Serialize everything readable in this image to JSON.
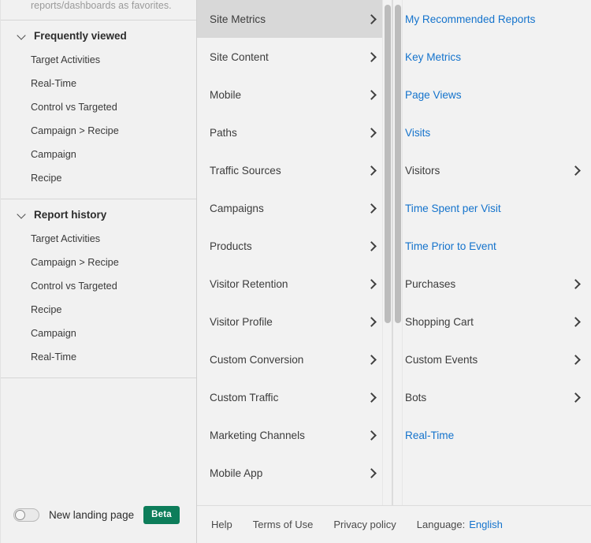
{
  "sidebar": {
    "intro_text": "reports/dashboards as favorites.",
    "sections": [
      {
        "title": "Frequently viewed",
        "items": [
          "Target Activities",
          "Real-Time",
          "Control vs Targeted",
          "Campaign > Recipe",
          "Campaign",
          "Recipe"
        ]
      },
      {
        "title": "Report history",
        "items": [
          "Target Activities",
          "Campaign > Recipe",
          "Control vs Targeted",
          "Recipe",
          "Campaign",
          "Real-Time"
        ]
      }
    ],
    "footer": {
      "toggle_state": "off",
      "landing_label": "New landing page",
      "beta_label": "Beta"
    }
  },
  "menu_column_1": {
    "items": [
      {
        "label": "Site Metrics",
        "has_submenu": true,
        "selected": true,
        "is_link": false
      },
      {
        "label": "Site Content",
        "has_submenu": true,
        "selected": false,
        "is_link": false
      },
      {
        "label": "Mobile",
        "has_submenu": true,
        "selected": false,
        "is_link": false
      },
      {
        "label": "Paths",
        "has_submenu": true,
        "selected": false,
        "is_link": false
      },
      {
        "label": "Traffic Sources",
        "has_submenu": true,
        "selected": false,
        "is_link": false
      },
      {
        "label": "Campaigns",
        "has_submenu": true,
        "selected": false,
        "is_link": false
      },
      {
        "label": "Products",
        "has_submenu": true,
        "selected": false,
        "is_link": false
      },
      {
        "label": "Visitor Retention",
        "has_submenu": true,
        "selected": false,
        "is_link": false
      },
      {
        "label": "Visitor Profile",
        "has_submenu": true,
        "selected": false,
        "is_link": false
      },
      {
        "label": "Custom Conversion",
        "has_submenu": true,
        "selected": false,
        "is_link": false
      },
      {
        "label": "Custom Traffic",
        "has_submenu": true,
        "selected": false,
        "is_link": false
      },
      {
        "label": "Marketing Channels",
        "has_submenu": true,
        "selected": false,
        "is_link": false
      },
      {
        "label": "Mobile App",
        "has_submenu": true,
        "selected": false,
        "is_link": false
      }
    ],
    "scrollbar": {
      "thumb_top_pct": 1,
      "thumb_height_pct": 63
    }
  },
  "menu_column_2": {
    "items": [
      {
        "label": "My Recommended Reports",
        "has_submenu": false,
        "is_link": true
      },
      {
        "label": "Key Metrics",
        "has_submenu": false,
        "is_link": true
      },
      {
        "label": "Page Views",
        "has_submenu": false,
        "is_link": true
      },
      {
        "label": "Visits",
        "has_submenu": false,
        "is_link": true
      },
      {
        "label": "Visitors",
        "has_submenu": true,
        "is_link": false
      },
      {
        "label": "Time Spent per Visit",
        "has_submenu": false,
        "is_link": true
      },
      {
        "label": "Time Prior to Event",
        "has_submenu": false,
        "is_link": true
      },
      {
        "label": "Purchases",
        "has_submenu": true,
        "is_link": false
      },
      {
        "label": "Shopping Cart",
        "has_submenu": true,
        "is_link": false
      },
      {
        "label": "Custom Events",
        "has_submenu": true,
        "is_link": false
      },
      {
        "label": "Bots",
        "has_submenu": true,
        "is_link": false
      },
      {
        "label": "Real-Time",
        "has_submenu": false,
        "is_link": true
      }
    ],
    "scrollbar": {
      "thumb_top_pct": 1,
      "thumb_height_pct": 63
    }
  },
  "footer": {
    "help": "Help",
    "terms": "Terms of Use",
    "privacy": "Privacy policy",
    "language_label": "Language:",
    "language_value": "English"
  },
  "colors": {
    "link_blue": "#1473cc",
    "beta_green": "#0d7d5a",
    "selected_gray": "#d8d8d8",
    "panel_bg": "#f2f2f2"
  }
}
